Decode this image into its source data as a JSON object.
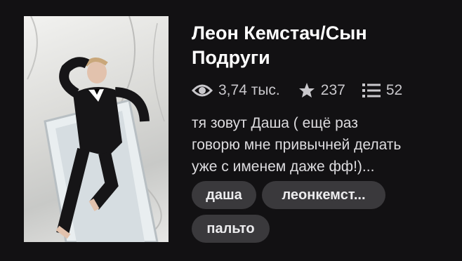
{
  "story": {
    "title": "Леон Кемстач/Сын Подруги",
    "stats": {
      "views": "3,74 тыс.",
      "votes": "237",
      "parts": "52"
    },
    "description_lines": [
      "тя зовут Даша ( ещё раз",
      "говорю мне привычней делать",
      "уже с именем даже фф!)..."
    ],
    "tags": [
      "даша",
      "леонкемст...",
      "пальто"
    ]
  },
  "icons": {
    "views": "eye-icon",
    "votes": "star-icon",
    "parts": "list-icon"
  },
  "colors": {
    "background": "#121113",
    "tag_background": "#3a393c",
    "meta_text": "#c9c8cc"
  }
}
